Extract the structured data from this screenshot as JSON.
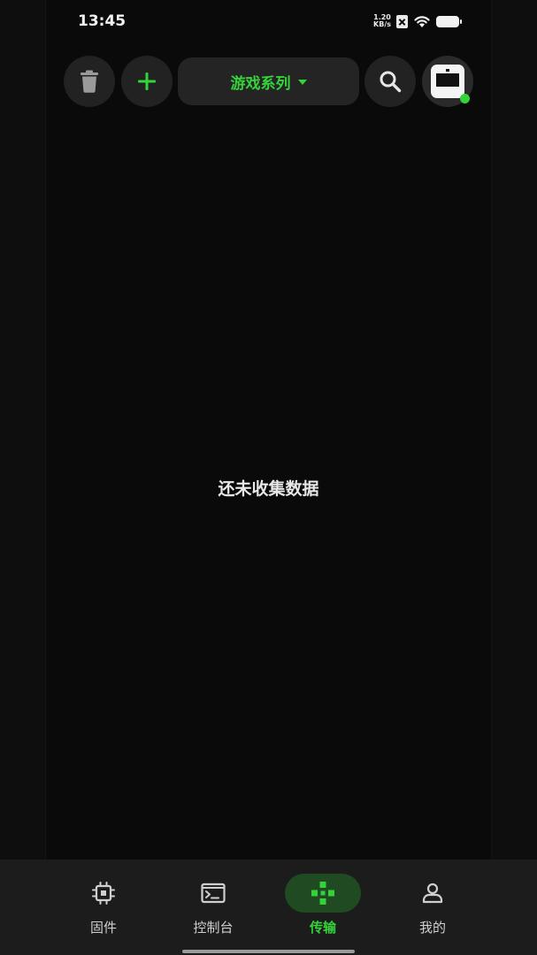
{
  "status_bar": {
    "time": "13:45",
    "net_speed_value": "1.20",
    "net_speed_unit": "KB/s",
    "icons": [
      "no-sim-icon",
      "wifi-icon",
      "battery-icon"
    ]
  },
  "toolbar": {
    "delete_icon": "trash-icon",
    "add_icon": "plus-icon",
    "series_label": "游戏系列",
    "search_icon": "search-icon",
    "device_status": "online"
  },
  "main": {
    "empty_message": "还未收集数据"
  },
  "bottom_nav": {
    "items": [
      {
        "label": "固件",
        "icon": "chip-icon",
        "active": false
      },
      {
        "label": "控制台",
        "icon": "terminal-icon",
        "active": false
      },
      {
        "label": "传输",
        "icon": "gamepad-icon",
        "active": true
      },
      {
        "label": "我的",
        "icon": "person-icon",
        "active": false
      }
    ]
  },
  "colors": {
    "accent": "#34d33a",
    "background": "#0a0a0a",
    "surface": "#222222",
    "nav_background": "#1c1c1c"
  }
}
